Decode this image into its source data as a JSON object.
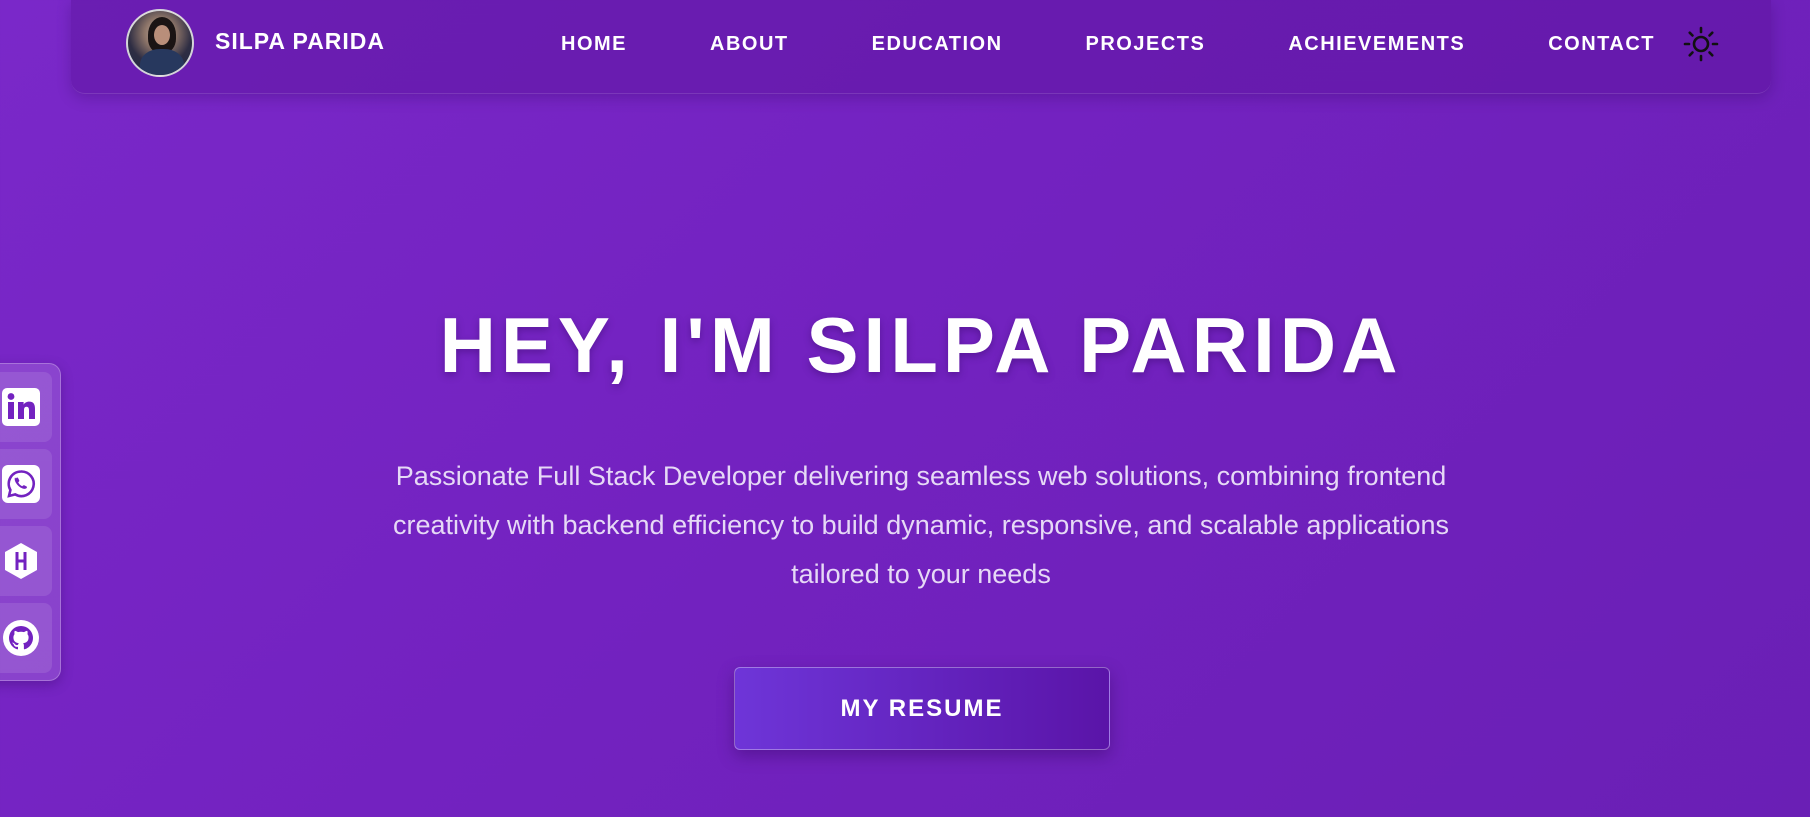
{
  "header": {
    "brand_name": "SILPA PARIDA",
    "avatar_alt": "profile-photo",
    "nav": [
      {
        "label": "HOME"
      },
      {
        "label": "ABOUT"
      },
      {
        "label": "EDUCATION"
      },
      {
        "label": "PROJECTS"
      },
      {
        "label": "ACHIEVEMENTS"
      },
      {
        "label": "CONTACT"
      }
    ],
    "theme_icon": "sun-icon"
  },
  "hero": {
    "title": "HEY, I'M SILPA PARIDA",
    "description": "Passionate Full Stack Developer delivering seamless web solutions, combining frontend creativity with backend efficiency to build dynamic, responsive, and scalable applications tailored to your needs",
    "resume_button": "MY RESUME"
  },
  "social": [
    {
      "icon": "linkedin-icon"
    },
    {
      "icon": "whatsapp-icon"
    },
    {
      "icon": "hashnode-icon"
    },
    {
      "icon": "github-icon"
    }
  ],
  "colors": {
    "background": "#7322c0",
    "navbar": "#6a1fb0",
    "button": "#5a14a8",
    "text": "#ffffff",
    "description_text": "#e6d9f6"
  }
}
